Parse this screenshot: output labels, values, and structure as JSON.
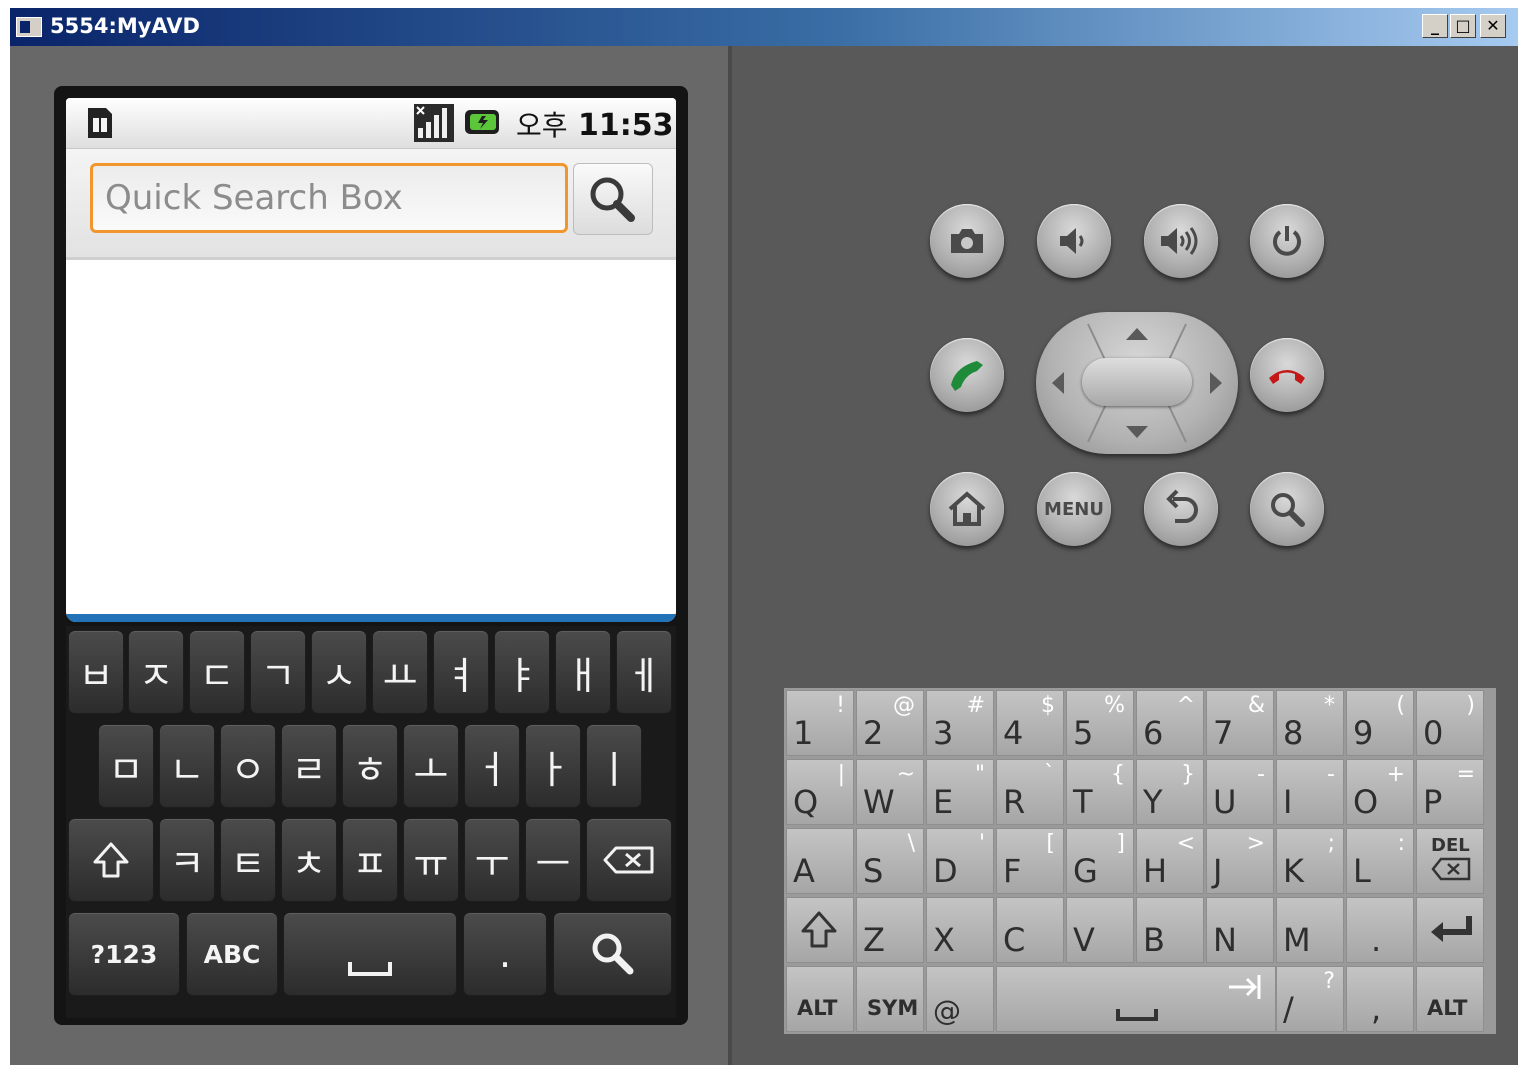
{
  "window": {
    "title": "5554:MyAVD",
    "buttons": {
      "minimize": "_",
      "maximize": "□",
      "close": "✕"
    }
  },
  "status_bar": {
    "time_prefix": "오후",
    "time": "11:53",
    "icons": [
      "sim-card-icon",
      "signal-icon",
      "battery-icon"
    ]
  },
  "search": {
    "placeholder": "Quick Search Box",
    "button_icon": "magnifier-icon"
  },
  "soft_keyboard": {
    "row1": [
      "ㅂ",
      "ㅈ",
      "ㄷ",
      "ㄱ",
      "ㅅ",
      "ㅛ",
      "ㅕ",
      "ㅑ",
      "ㅐ",
      "ㅔ"
    ],
    "row2": [
      "ㅁ",
      "ㄴ",
      "ㅇ",
      "ㄹ",
      "ㅎ",
      "ㅗ",
      "ㅓ",
      "ㅏ",
      "ㅣ"
    ],
    "row3": [
      "ㅋ",
      "ㅌ",
      "ㅊ",
      "ㅍ",
      "ㅠ",
      "ㅜ",
      "ㅡ"
    ],
    "row3_special": {
      "shift": "shift-icon",
      "delete": "backspace-icon"
    },
    "row4": {
      "symbols": "?123",
      "abc": "ABC",
      "space": "space-icon",
      "period": ".",
      "search": "search-icon"
    }
  },
  "hardware_buttons": {
    "row1": [
      "camera-icon",
      "volume-down-icon",
      "volume-up-icon",
      "power-icon"
    ],
    "call": "call-icon",
    "end_call": "end-call-icon",
    "dpad": [
      "dpad-up-icon",
      "dpad-down-icon",
      "dpad-left-icon",
      "dpad-right-icon",
      "dpad-center"
    ],
    "row3": {
      "home": "home-icon",
      "menu": "MENU",
      "back": "back-icon",
      "search": "search-icon"
    }
  },
  "hardware_keyboard": {
    "row1": [
      {
        "main": "1",
        "alt": "!"
      },
      {
        "main": "2",
        "alt": "@"
      },
      {
        "main": "3",
        "alt": "#"
      },
      {
        "main": "4",
        "alt": "$"
      },
      {
        "main": "5",
        "alt": "%"
      },
      {
        "main": "6",
        "alt": "^"
      },
      {
        "main": "7",
        "alt": "&"
      },
      {
        "main": "8",
        "alt": "*"
      },
      {
        "main": "9",
        "alt": "("
      },
      {
        "main": "0",
        "alt": ")"
      }
    ],
    "row2": [
      {
        "main": "Q",
        "alt": "|"
      },
      {
        "main": "W",
        "alt": "~"
      },
      {
        "main": "E",
        "alt": "\""
      },
      {
        "main": "R",
        "alt": "`"
      },
      {
        "main": "T",
        "alt": "{"
      },
      {
        "main": "Y",
        "alt": "}"
      },
      {
        "main": "U",
        "alt": "-"
      },
      {
        "main": "I",
        "alt": "-"
      },
      {
        "main": "O",
        "alt": "+"
      },
      {
        "main": "P",
        "alt": "="
      }
    ],
    "row3": [
      {
        "main": "A",
        "alt": ""
      },
      {
        "main": "S",
        "alt": "\\"
      },
      {
        "main": "D",
        "alt": "'"
      },
      {
        "main": "F",
        "alt": "["
      },
      {
        "main": "G",
        "alt": "]"
      },
      {
        "main": "H",
        "alt": "<"
      },
      {
        "main": "J",
        "alt": ">"
      },
      {
        "main": "K",
        "alt": ";"
      },
      {
        "main": "L",
        "alt": ":"
      },
      {
        "main": "DEL",
        "alt": ""
      }
    ],
    "row4": [
      {
        "main": "shift-icon",
        "alt": ""
      },
      {
        "main": "Z",
        "alt": ""
      },
      {
        "main": "X",
        "alt": ""
      },
      {
        "main": "C",
        "alt": ""
      },
      {
        "main": "V",
        "alt": ""
      },
      {
        "main": "B",
        "alt": ""
      },
      {
        "main": "N",
        "alt": ""
      },
      {
        "main": "M",
        "alt": ""
      },
      {
        "main": ".",
        "alt": ""
      },
      {
        "main": "enter-icon",
        "alt": ""
      }
    ],
    "row5": {
      "alt_left": "ALT",
      "sym": "SYM",
      "at": "@",
      "space": "space-icon",
      "tab": "tab-icon",
      "slash": "/",
      "question": "?",
      "comma": ",",
      "alt_right": "ALT"
    }
  }
}
